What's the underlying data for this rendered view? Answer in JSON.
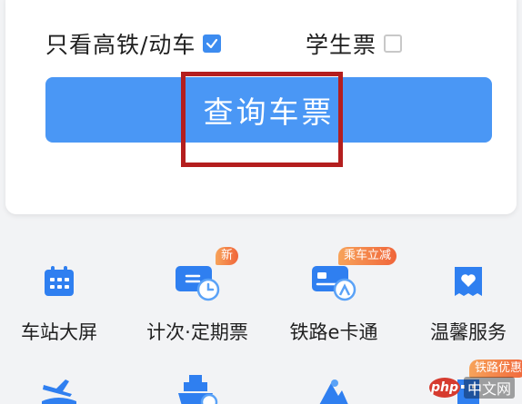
{
  "options": {
    "high_speed_label": "只看高铁/动车",
    "high_speed_checked": true,
    "student_label": "学生票",
    "student_checked": false
  },
  "search_button": {
    "label": "查询车票"
  },
  "colors": {
    "primary": "#4a97f5",
    "highlight_border": "#b41e1e",
    "badge": "#f0653a"
  },
  "services": [
    {
      "label": "车站大屏",
      "icon": "calendar-screen-icon",
      "badge": ""
    },
    {
      "label": "计次·定期票",
      "icon": "ticket-card-icon",
      "badge": "新"
    },
    {
      "label": "铁路e卡通",
      "icon": "rail-card-icon",
      "badge": "乘车立减"
    },
    {
      "label": "温馨服务",
      "icon": "heart-service-icon",
      "badge": ""
    }
  ],
  "services_row2": [
    {
      "icon": "plane-train-icon",
      "badge": ""
    },
    {
      "icon": "ship-icon",
      "badge": ""
    },
    {
      "icon": "mountain-icon",
      "badge": ""
    },
    {
      "icon": "building-icon",
      "badge": "铁路优惠"
    }
  ],
  "watermark": {
    "logo": "php",
    "text": "中文网"
  }
}
